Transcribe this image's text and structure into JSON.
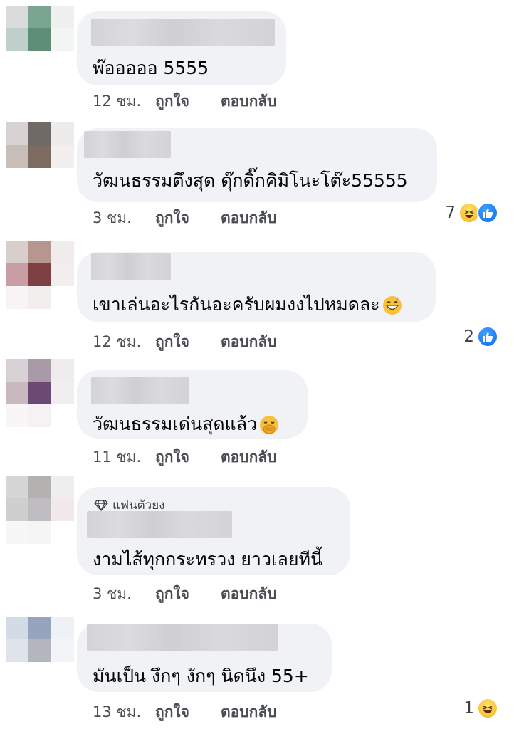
{
  "colors": {
    "bubble": "#f0f2f5",
    "meta_text": "#4a4d52",
    "like_blue": "#1877f2",
    "haha_yellow": "#f8c13a"
  },
  "comments": [
    {
      "text": "พ๊อออออ 5555",
      "time": "12 ชม.",
      "like_label": "ถูกใจ",
      "reply_label": "ตอบกลับ",
      "reaction_count": "",
      "reactions": []
    },
    {
      "text": "วัฒนธรรมตึงสุด ดุ๊กดิ๊กคิมิโนะโต๊ะ55555",
      "time": "3 ชม.",
      "like_label": "ถูกใจ",
      "reply_label": "ตอบกลับ",
      "reaction_count": "7",
      "reactions": [
        "haha-icon",
        "like-icon"
      ]
    },
    {
      "text": "เขาเล่นอะไรกันอะครับผมงงไปหมดละ",
      "text_emoji": "grinning-sweat-emoji",
      "time": "12 ชม.",
      "like_label": "ถูกใจ",
      "reply_label": "ตอบกลับ",
      "reaction_count": "2",
      "reactions": [
        "like-icon"
      ]
    },
    {
      "text": "วัฒนธรรมเด่นสุดแล้ว",
      "text_emoji": "hand-over-mouth-emoji",
      "time": "11 ชม.",
      "like_label": "ถูกใจ",
      "reply_label": "ตอบกลับ",
      "reaction_count": "",
      "reactions": []
    },
    {
      "badge": "แฟนตัวยง",
      "badge_icon": "diamond-icon",
      "text": "งามไส้ทุกกระทรวง ยาวเลยทีนี้",
      "time": "3 ชม.",
      "like_label": "ถูกใจ",
      "reply_label": "ตอบกลับ",
      "reaction_count": "",
      "reactions": []
    },
    {
      "text": "มันเป็น งึกๆ งักๆ นิดนึง 55+",
      "time": "13 ชม.",
      "like_label": "ถูกใจ",
      "reply_label": "ตอบกลับ",
      "reaction_count": "1",
      "reactions": [
        "haha-icon"
      ]
    }
  ]
}
